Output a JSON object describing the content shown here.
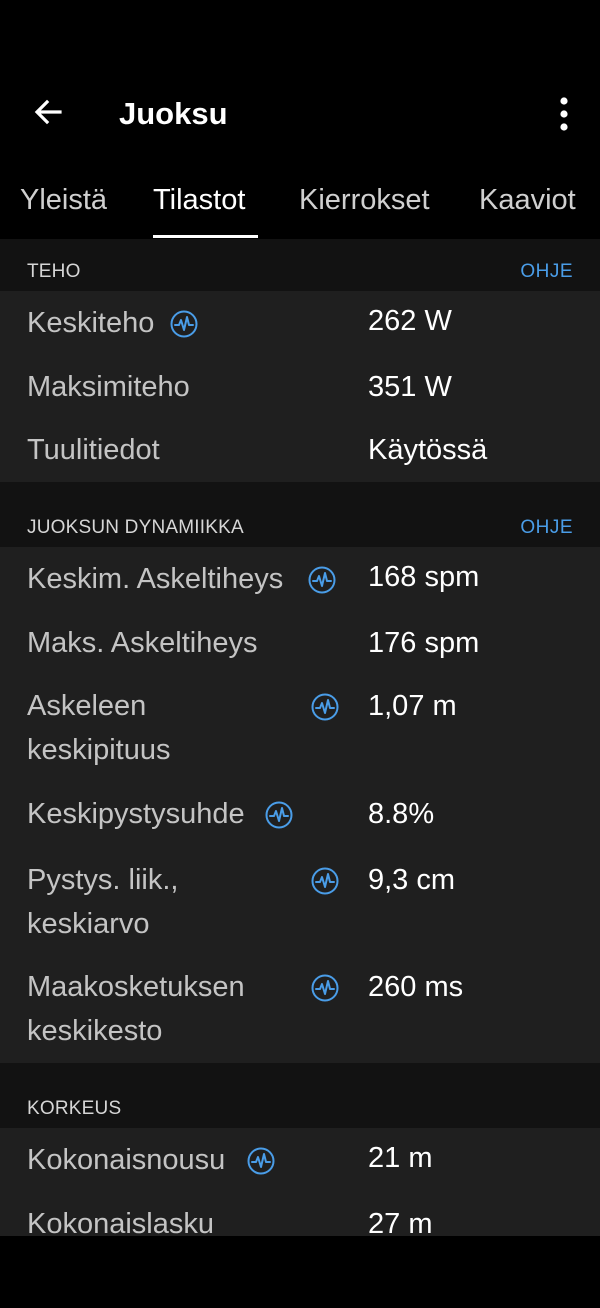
{
  "header": {
    "title": "Juoksu",
    "back_icon": "arrow-left-icon",
    "menu_icon": "more-vertical-icon"
  },
  "tabs": [
    {
      "label": "Yleistä",
      "active": false
    },
    {
      "label": "Tilastot",
      "active": true
    },
    {
      "label": "Kierrokset",
      "active": false
    },
    {
      "label": "Kaaviot",
      "active": false
    }
  ],
  "sections": {
    "power": {
      "title": "TEHO",
      "help": "OHJE",
      "rows": [
        {
          "label": "Keskiteho",
          "value": "262 W",
          "has_icon": true
        },
        {
          "label": "Maksimiteho",
          "value": "351 W",
          "has_icon": false
        },
        {
          "label": "Tuulitiedot",
          "value": "Käytössä",
          "has_icon": false
        }
      ]
    },
    "dynamics": {
      "title": "JUOKSUN DYNAMIIKKA",
      "help": "OHJE",
      "rows": [
        {
          "label": "Keskim. Askeltiheys",
          "value": "168 spm",
          "has_icon": true
        },
        {
          "label": "Maks. Askeltiheys",
          "value": "176 spm",
          "has_icon": false
        },
        {
          "label_line1": "Askeleen",
          "label_line2": "keskipituus",
          "value": "1,07 m",
          "has_icon": true
        },
        {
          "label": "Keskipystysuhde",
          "value": "8.8%",
          "has_icon": true
        },
        {
          "label_line1": "Pystys. liik.,",
          "label_line2": "keskiarvo",
          "value": "9,3 cm",
          "has_icon": true
        },
        {
          "label_line1": "Maakosketuksen",
          "label_line2": "keskikesto",
          "value": "260 ms",
          "has_icon": true
        }
      ]
    },
    "elevation": {
      "title": "KORKEUS",
      "rows": [
        {
          "label": "Kokonaisnousu",
          "value": "21 m",
          "has_icon": true
        },
        {
          "label": "Kokonaislasku",
          "value": "27 m",
          "has_icon": false
        }
      ]
    }
  },
  "colors": {
    "accent": "#4a9de8",
    "background": "#000000",
    "section_header": "#121212",
    "section_body": "#1f1f1f"
  },
  "icon_name": "pulse-chart-icon"
}
